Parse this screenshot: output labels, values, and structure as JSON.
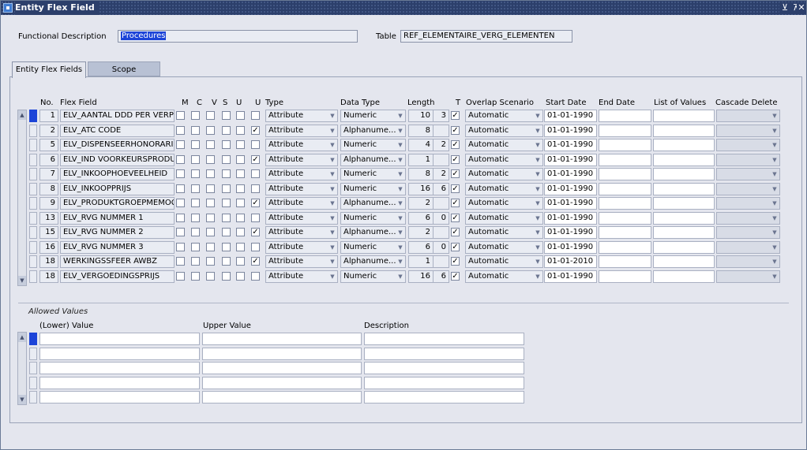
{
  "window": {
    "title": "Entity Flex Field"
  },
  "header": {
    "functional_description_label": "Functional Description",
    "functional_description_value": "Procedures",
    "table_label": "Table",
    "table_value": "REF_ELEMENTAIRE_VERG_ELEMENTEN"
  },
  "tabs": [
    {
      "label": "Entity Flex Fields",
      "active": true
    },
    {
      "label": "Scope",
      "active": false
    }
  ],
  "grid": {
    "columns": {
      "no": "No.",
      "flex_field": "Flex Field",
      "m": "M",
      "c": "C",
      "v": "V",
      "s": "S",
      "u1": "U",
      "u2": "U",
      "type": "Type",
      "data_type": "Data Type",
      "length": "Length",
      "t": "T",
      "overlap": "Overlap Scenario",
      "start": "Start Date",
      "end": "End Date",
      "lov": "List of Values",
      "cascade": "Cascade Delete"
    },
    "rows": [
      {
        "no": "1",
        "field": "ELV_AANTAL DDD PER VERP",
        "m": false,
        "c": false,
        "v": false,
        "s": false,
        "u1": false,
        "u2": false,
        "type": "Attribute",
        "data_type": "Numeric",
        "length": "10",
        "decimals": "3",
        "t": true,
        "overlap": "Automatic",
        "start": "01-01-1990",
        "end": "",
        "lov": "",
        "cascade": ""
      },
      {
        "no": "2",
        "field": "ELV_ATC CODE",
        "m": false,
        "c": false,
        "v": false,
        "s": false,
        "u1": false,
        "u2": true,
        "type": "Attribute",
        "data_type": "Alphanume...",
        "length": "8",
        "decimals": "",
        "t": true,
        "overlap": "Automatic",
        "start": "01-01-1990",
        "end": "",
        "lov": "",
        "cascade": ""
      },
      {
        "no": "5",
        "field": "ELV_DISPENSEERHONORARIU",
        "m": false,
        "c": false,
        "v": false,
        "s": false,
        "u1": false,
        "u2": false,
        "type": "Attribute",
        "data_type": "Numeric",
        "length": "4",
        "decimals": "2",
        "t": true,
        "overlap": "Automatic",
        "start": "01-01-1990",
        "end": "",
        "lov": "",
        "cascade": ""
      },
      {
        "no": "6",
        "field": "ELV_IND VOORKEURSPRODUC",
        "m": false,
        "c": false,
        "v": false,
        "s": false,
        "u1": false,
        "u2": true,
        "type": "Attribute",
        "data_type": "Alphanume...",
        "length": "1",
        "decimals": "",
        "t": true,
        "overlap": "Automatic",
        "start": "01-01-1990",
        "end": "",
        "lov": "",
        "cascade": ""
      },
      {
        "no": "7",
        "field": "ELV_INKOOPHOEVEELHEID",
        "m": false,
        "c": false,
        "v": false,
        "s": false,
        "u1": false,
        "u2": false,
        "type": "Attribute",
        "data_type": "Numeric",
        "length": "8",
        "decimals": "2",
        "t": true,
        "overlap": "Automatic",
        "start": "01-01-1990",
        "end": "",
        "lov": "",
        "cascade": ""
      },
      {
        "no": "8",
        "field": "ELV_INKOOPPRIJS",
        "m": false,
        "c": false,
        "v": false,
        "s": false,
        "u1": false,
        "u2": false,
        "type": "Attribute",
        "data_type": "Numeric",
        "length": "16",
        "decimals": "6",
        "t": true,
        "overlap": "Automatic",
        "start": "01-01-1990",
        "end": "",
        "lov": "",
        "cascade": ""
      },
      {
        "no": "9",
        "field": "ELV_PRODUKTGROEPMEMOCO",
        "m": false,
        "c": false,
        "v": false,
        "s": false,
        "u1": false,
        "u2": true,
        "type": "Attribute",
        "data_type": "Alphanume...",
        "length": "2",
        "decimals": "",
        "t": true,
        "overlap": "Automatic",
        "start": "01-01-1990",
        "end": "",
        "lov": "",
        "cascade": ""
      },
      {
        "no": "13",
        "field": "ELV_RVG NUMMER 1",
        "m": false,
        "c": false,
        "v": false,
        "s": false,
        "u1": false,
        "u2": false,
        "type": "Attribute",
        "data_type": "Numeric",
        "length": "6",
        "decimals": "0",
        "t": true,
        "overlap": "Automatic",
        "start": "01-01-1990",
        "end": "",
        "lov": "",
        "cascade": ""
      },
      {
        "no": "15",
        "field": "ELV_RVG NUMMER 2",
        "m": false,
        "c": false,
        "v": false,
        "s": false,
        "u1": false,
        "u2": true,
        "type": "Attribute",
        "data_type": "Alphanume...",
        "length": "2",
        "decimals": "",
        "t": true,
        "overlap": "Automatic",
        "start": "01-01-1990",
        "end": "",
        "lov": "",
        "cascade": ""
      },
      {
        "no": "16",
        "field": "ELV_RVG NUMMER 3",
        "m": false,
        "c": false,
        "v": false,
        "s": false,
        "u1": false,
        "u2": false,
        "type": "Attribute",
        "data_type": "Numeric",
        "length": "6",
        "decimals": "0",
        "t": true,
        "overlap": "Automatic",
        "start": "01-01-1990",
        "end": "",
        "lov": "",
        "cascade": ""
      },
      {
        "no": "18",
        "field": "WERKINGSSFEER AWBZ",
        "m": false,
        "c": false,
        "v": false,
        "s": false,
        "u1": false,
        "u2": true,
        "type": "Attribute",
        "data_type": "Alphanume...",
        "length": "1",
        "decimals": "",
        "t": true,
        "overlap": "Automatic",
        "start": "01-01-2010",
        "end": "",
        "lov": "",
        "cascade": ""
      },
      {
        "no": "18",
        "field": "ELV_VERGOEDINGSPRIJS",
        "m": false,
        "c": false,
        "v": false,
        "s": false,
        "u1": false,
        "u2": false,
        "type": "Attribute",
        "data_type": "Numeric",
        "length": "16",
        "decimals": "6",
        "t": true,
        "overlap": "Automatic",
        "start": "01-01-1990",
        "end": "",
        "lov": "",
        "cascade": ""
      }
    ]
  },
  "allowed_values": {
    "title": "Allowed Values",
    "col_lower": "(Lower) Value",
    "col_upper": "Upper Value",
    "col_description": "Description",
    "rows": [
      {
        "lower": "",
        "upper": "",
        "description": ""
      },
      {
        "lower": "",
        "upper": "",
        "description": ""
      },
      {
        "lower": "",
        "upper": "",
        "description": ""
      },
      {
        "lower": "",
        "upper": "",
        "description": ""
      },
      {
        "lower": "",
        "upper": "",
        "description": ""
      }
    ]
  },
  "icons": {
    "title_icon": "app-icon",
    "minimize": "minimize-icon",
    "restore": "restore-icon",
    "close": "close-icon",
    "combo": "chevron-down-icon",
    "check": "checkmark-icon"
  }
}
